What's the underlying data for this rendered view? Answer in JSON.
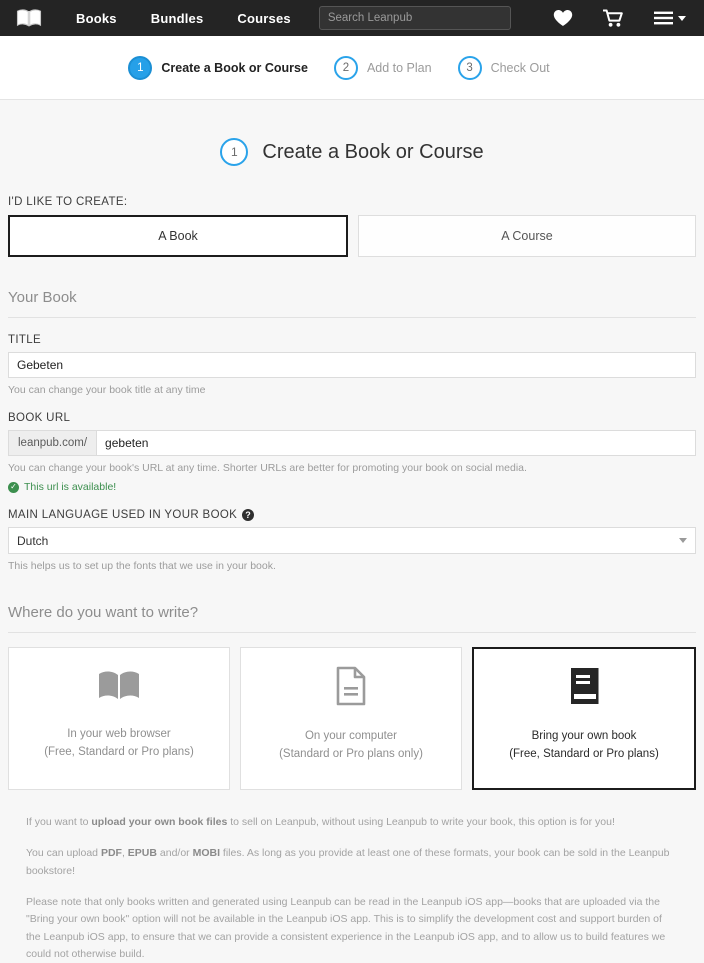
{
  "header": {
    "logo_icon": "open-book-logo",
    "nav": [
      {
        "label": "Books"
      },
      {
        "label": "Bundles"
      },
      {
        "label": "Courses"
      }
    ],
    "search": {
      "placeholder": "Search Leanpub",
      "value": ""
    },
    "icons": [
      {
        "name": "heart-icon"
      },
      {
        "name": "cart-icon"
      },
      {
        "name": "hamburger-menu-icon"
      }
    ]
  },
  "steps": [
    {
      "number": "1",
      "label": "Create a Book or Course",
      "active": true
    },
    {
      "number": "2",
      "label": "Add to Plan",
      "active": false
    },
    {
      "number": "3",
      "label": "Check Out",
      "active": false
    }
  ],
  "page": {
    "step_number": "1",
    "title": "Create a Book or Course"
  },
  "create_type": {
    "label": "I'D LIKE TO CREATE:",
    "options": [
      {
        "label": "A Book",
        "selected": true
      },
      {
        "label": "A Course",
        "selected": false
      }
    ]
  },
  "your_book": {
    "heading": "Your Book",
    "title_field": {
      "label": "TITLE",
      "value": "Gebeten",
      "placeholder": "",
      "help": "You can change your book title at any time"
    },
    "url_field": {
      "label": "BOOK URL",
      "prefix": "leanpub.com/",
      "value": "gebeten",
      "placeholder": "",
      "help": "You can change your book's URL at any time. Shorter URLs are better for promoting your book on social media.",
      "status": "This url is available!",
      "status_color": "#3c8f4e"
    },
    "language_field": {
      "label": "MAIN LANGUAGE USED IN YOUR BOOK",
      "help_icon": "question-mark-icon",
      "value": "Dutch",
      "help": "This helps us to set up the fonts that we use in your book."
    }
  },
  "where_write": {
    "heading": "Where do you want to write?",
    "cards": [
      {
        "icon": "open-book-icon",
        "line1": "In your web browser",
        "line2": "(Free, Standard or Pro plans)",
        "selected": false
      },
      {
        "icon": "document-icon",
        "line1": "On your computer",
        "line2": "(Standard or Pro plans only)",
        "selected": false
      },
      {
        "icon": "closed-book-icon",
        "line1": "Bring your own book",
        "line2": "(Free, Standard or Pro plans)",
        "selected": true
      }
    ]
  },
  "info": {
    "para1_prefix": "If you want to ",
    "para1_bold": "upload your own book files",
    "para1_suffix": " to sell on Leanpub, without using Leanpub to write your book, this option is for you!",
    "para2_prefix": "You can upload ",
    "para2_bold1": "PDF",
    "para2_mid1": ", ",
    "para2_bold2": "EPUB",
    "para2_mid2": " and/or ",
    "para2_bold3": "MOBI",
    "para2_suffix": " files. As long as you provide at least one of these formats, your book can be sold in the Leanpub bookstore!",
    "para3": "Please note that only books written and generated using Leanpub can be read in the Leanpub iOS app—books that are uploaded via the \"Bring your own book\" option will not be available in the Leanpub iOS app. This is to simplify the development cost and support burden of the Leanpub iOS app, to ensure that we can provide a consistent experience in the Leanpub iOS app, and to allow us to build features we could not otherwise build."
  },
  "colors": {
    "accent_blue": "#26a0e8",
    "nav_dark": "#242424",
    "success_green": "#3c8f4e",
    "page_bg": "#f7f7f7"
  }
}
